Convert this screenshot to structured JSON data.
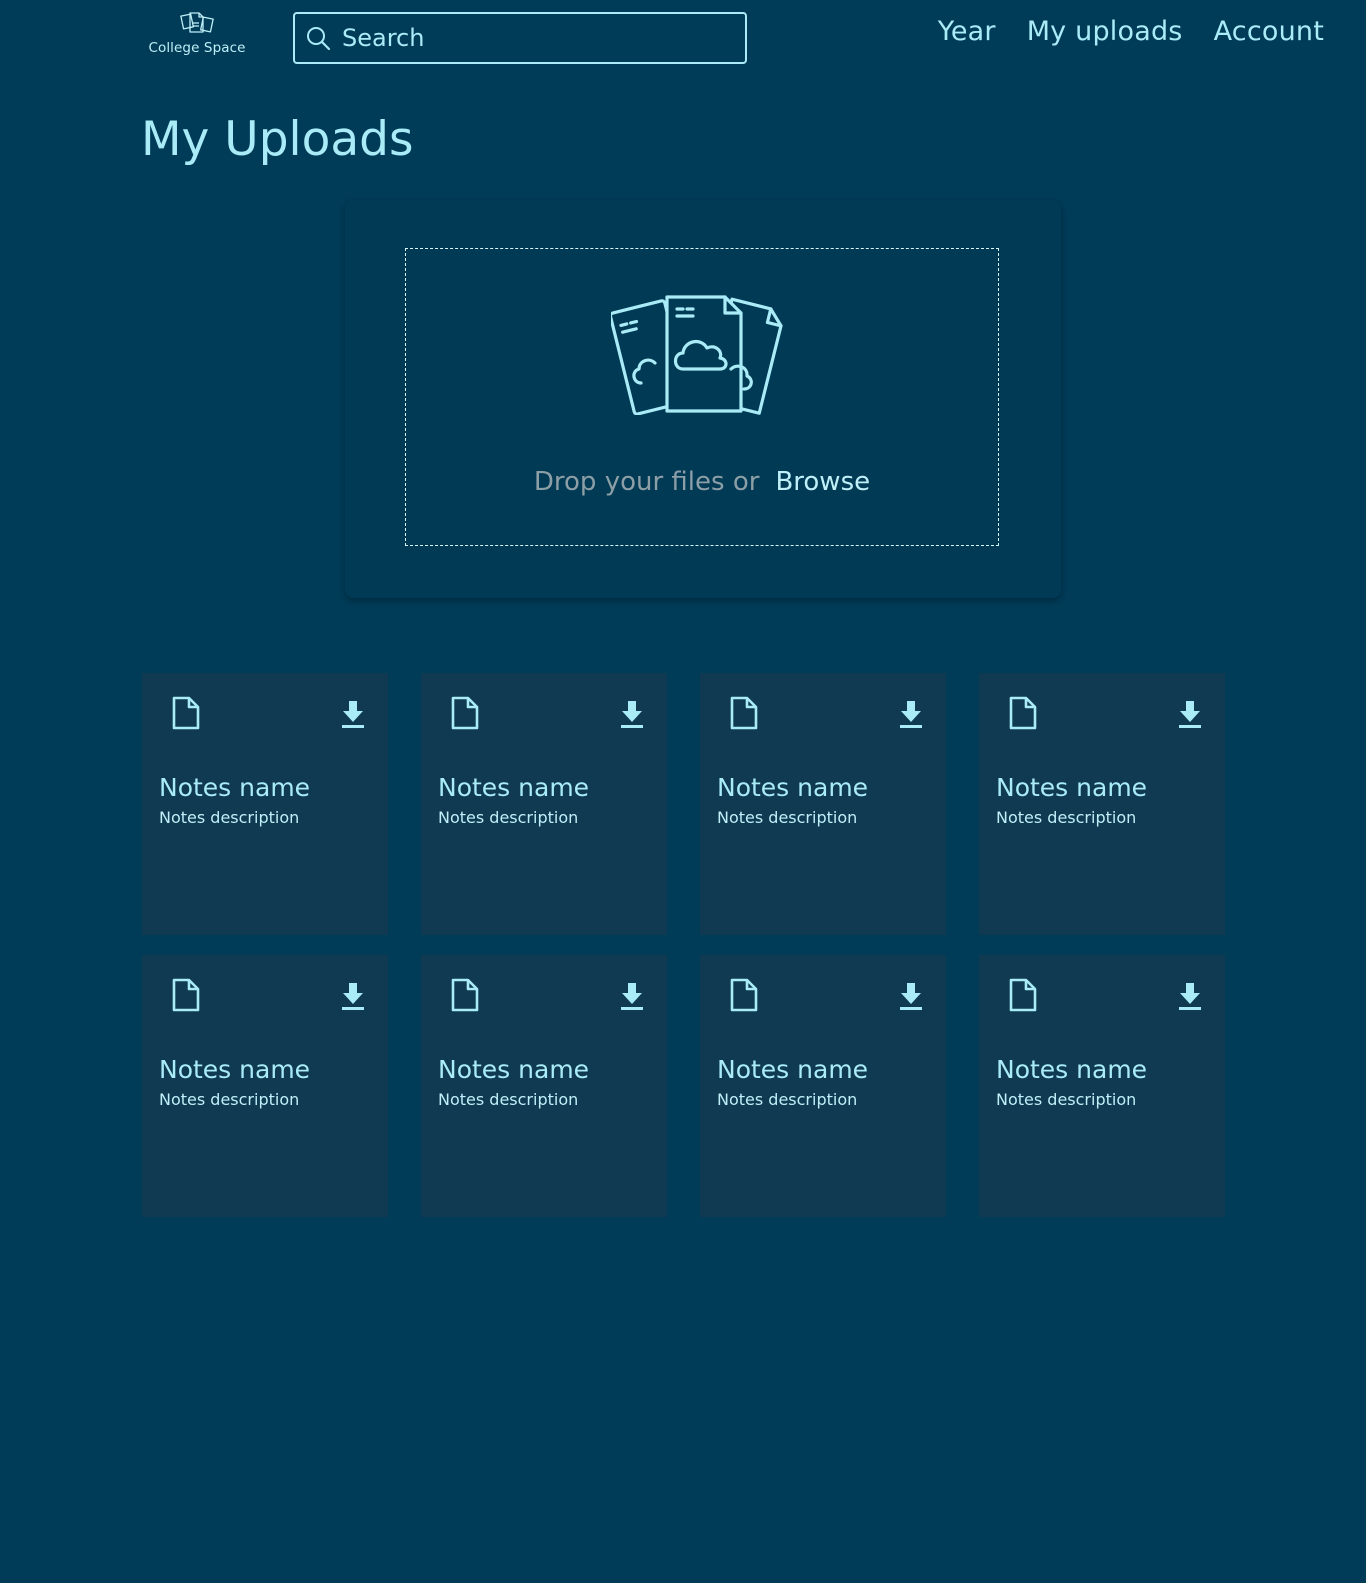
{
  "header": {
    "logo_text": "College Space",
    "search": {
      "placeholder": "Search",
      "value": ""
    },
    "nav": [
      "Year",
      "My uploads",
      "Account"
    ]
  },
  "page_title": "My Uploads",
  "upload": {
    "drop_text": "Drop your files or",
    "browse_label": "Browse"
  },
  "notes": [
    {
      "name": "Notes name",
      "description": "Notes description"
    },
    {
      "name": "Notes name",
      "description": "Notes description"
    },
    {
      "name": "Notes name",
      "description": "Notes description"
    },
    {
      "name": "Notes name",
      "description": "Notes description"
    },
    {
      "name": "Notes name",
      "description": "Notes description"
    },
    {
      "name": "Notes name",
      "description": "Notes description"
    },
    {
      "name": "Notes name",
      "description": "Notes description"
    },
    {
      "name": "Notes name",
      "description": "Notes description"
    }
  ],
  "icons": {
    "logo": "documents-logo-icon",
    "search": "search-icon",
    "upload": "cloud-documents-icon",
    "file": "file-icon",
    "download": "download-icon"
  },
  "colors": {
    "background": "#003c58",
    "card": "#0f3a51",
    "accent": "#a9ebf7",
    "muted_text": "#8c9ea6"
  }
}
